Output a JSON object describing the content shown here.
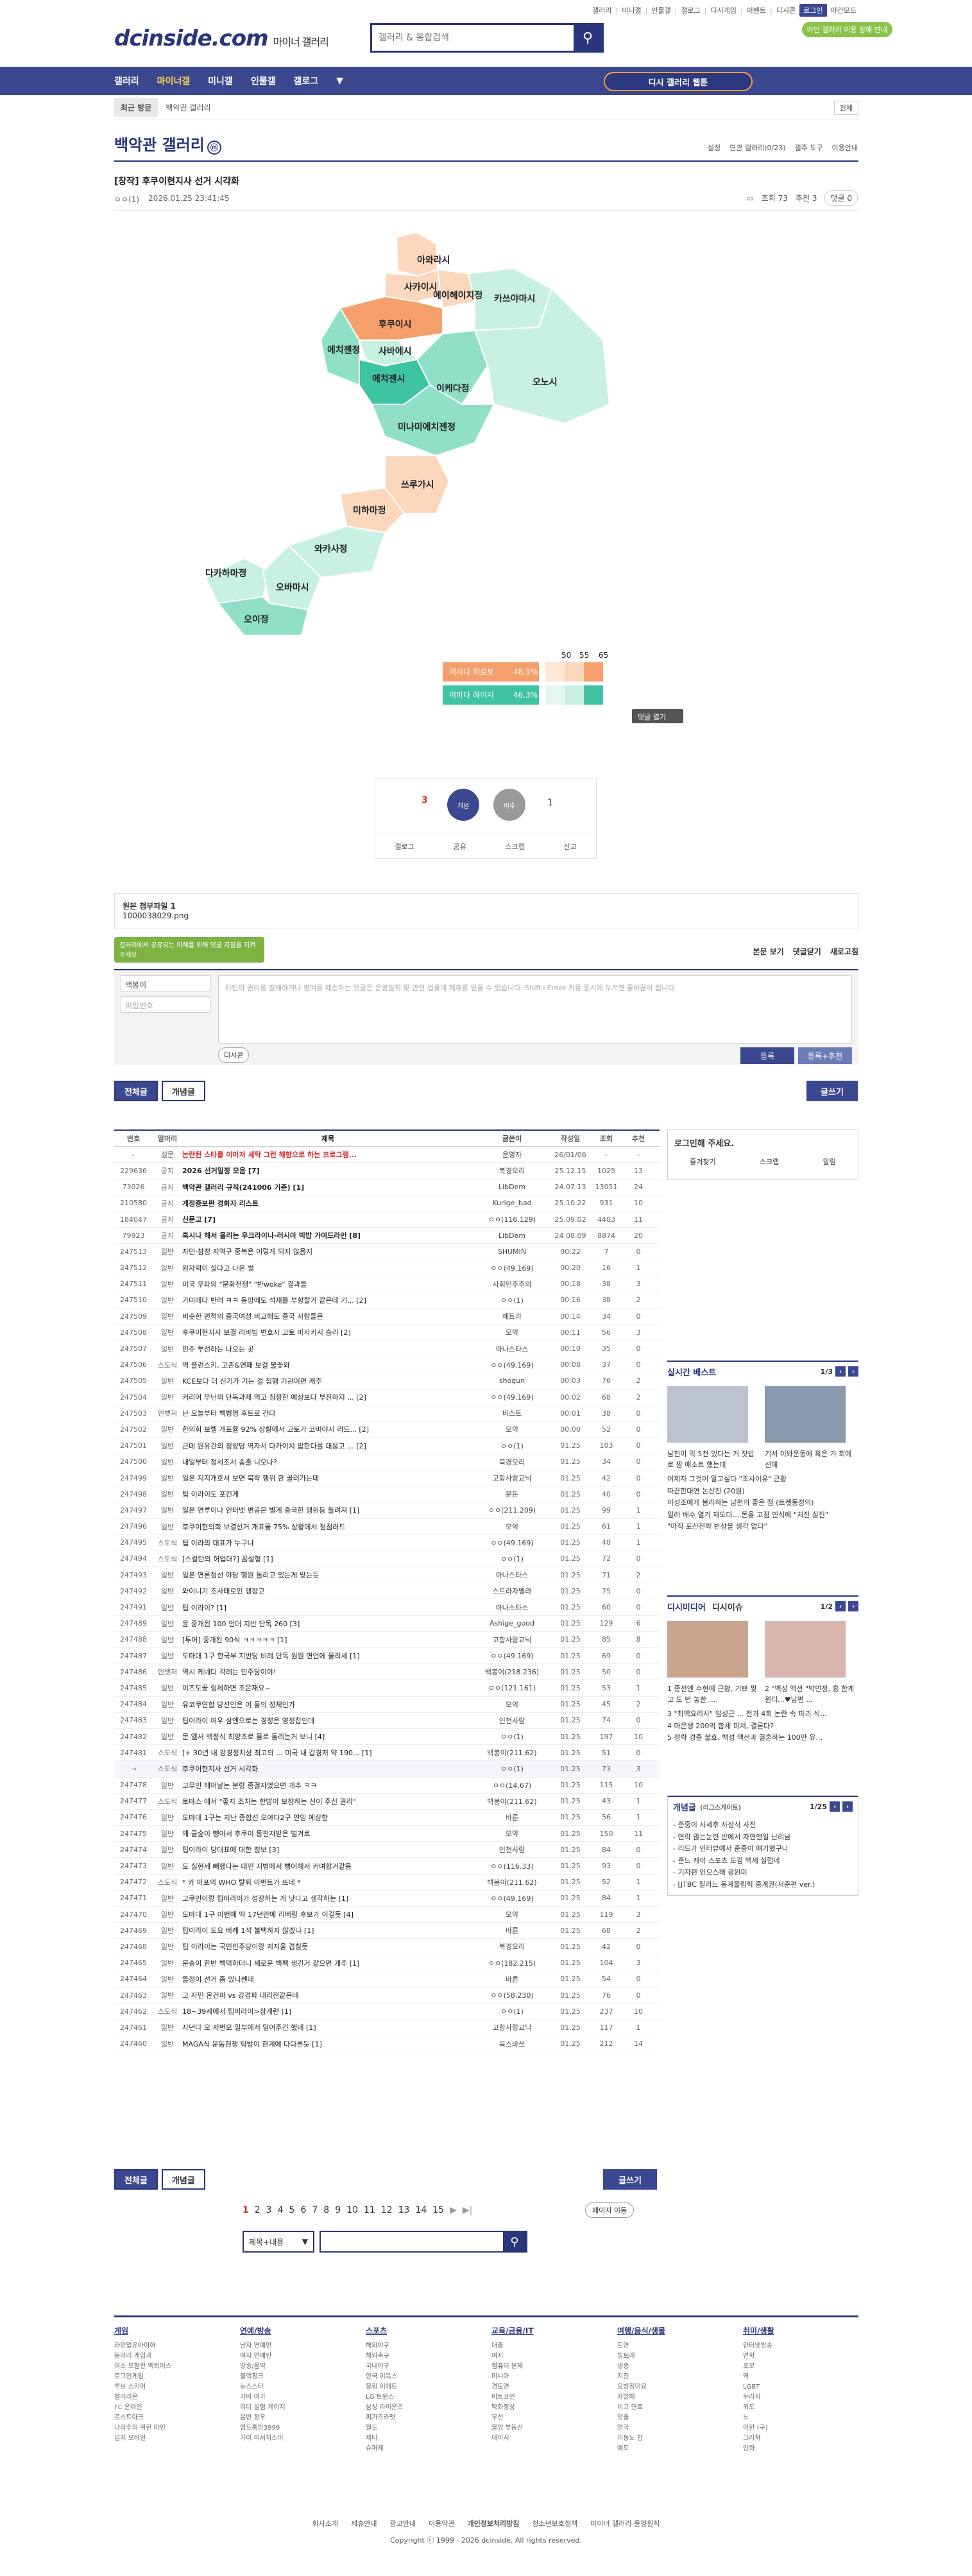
{
  "util": {
    "links": [
      "갤러리",
      "미니갤",
      "인물갤",
      "갤로그",
      "디시게임",
      "이벤트",
      "디시콘"
    ],
    "login": "로그인",
    "lang": "야간모드"
  },
  "logo": {
    "main": "dcinside.com",
    "sub": "마이너 갤러리"
  },
  "search": {
    "placeholder": "갤러리 & 통합검색"
  },
  "notice_badge": "마인 갤러리 이용 장애 안내",
  "gnb": {
    "items": [
      "갤러리",
      "마이너갤",
      "미니갤",
      "인물갤",
      "갤로그"
    ],
    "recent": "디시 갤러리 웹툰"
  },
  "bread": {
    "tab": "최근 방문",
    "crumb": "백악관 갤러리",
    "all": "전체"
  },
  "gallery": {
    "title": "백악관 갤러리",
    "mark": "ⓜ",
    "options": [
      "설정",
      "연관 갤러리(0/23)",
      "갤주 도구",
      "이용안내"
    ]
  },
  "post": {
    "title": "[창작] 후쿠이현지사 선거 시각화",
    "author": "ㅇㅇ(1)",
    "date": "2026.01.25 23:41:45",
    "views": "조회 73",
    "rec": "추천 3",
    "comments": "댓글 0"
  },
  "map": {
    "regions": [
      "아와라시",
      "사카이시",
      "후쿠이시",
      "에이헤이지정",
      "카쓰야마시",
      "오노시",
      "에치젠정",
      "사바에시",
      "에치젠시",
      "이케다정",
      "미나미에치젠정",
      "쓰루가시",
      "미하마정",
      "와카사정",
      "다카하마정",
      "오바마시",
      "오이정"
    ],
    "legend": {
      "a": "이시다 히로토",
      "a_pct": "48.1%",
      "b": "이마다 하이지",
      "b_pct": "46.3%",
      "ticks": [
        "50",
        "55",
        "65"
      ],
      "btn": "댓글 열기"
    },
    "colors": {
      "orange_dark": "#f5a06c",
      "orange_light": "#fbd7bd",
      "green_dark": "#3fc4a2",
      "green_mid": "#8fe0c6",
      "green_light": "#c8f1e2"
    }
  },
  "vote": {
    "up_label": "개념",
    "down_label": "비추",
    "up_count": "3",
    "fix": "3",
    "down_count": "1",
    "actions": [
      "갤로그",
      "공유",
      "스크랩",
      "신고"
    ]
  },
  "file": {
    "label": "원본 첨부파일 1",
    "name": "1000038029.png"
  },
  "comment": {
    "tooltip": "갤러리에서 공유되는 이해를 위해 댓글 지침을 지켜주세요",
    "order": [
      "본문 보기",
      "댓글닫기",
      "새로고침"
    ],
    "nick": "백봉이",
    "pw": "비밀번호",
    "placeholder": "타인의 권리를 침해하거나 명예를 훼손하는 댓글은 운영원칙 및 관련 법률에 제재를 받을 수 있습니다. Shift+Enter 키를 동시에 누르면 줄바꿈이 됩니다.",
    "dccon": "디시콘",
    "submit": "등록",
    "submit_rec": "등록+추천"
  },
  "tabs": {
    "all": "전체글",
    "best": "개념글",
    "write": "글쓰기"
  },
  "list_header": [
    "번호",
    "말머리",
    "제목",
    "글쓴이",
    "작성일",
    "조회",
    "추천"
  ],
  "list": [
    [
      "-",
      "설문",
      "논란된 스타를 이마저 세탁 그런 해함으로 하는 프로그램...",
      "운영자",
      "26/01/06",
      "-",
      "-"
    ],
    [
      "229636",
      "공지",
      "2026 선거일정 모음 [7]",
      "북경오리",
      "25.12.15",
      "1025",
      "13"
    ],
    [
      "73026",
      "공지",
      "백악관 갤러리 규칙(241006 기준) [1]",
      "LibDem",
      "24.07.13",
      "13051",
      "24"
    ],
    [
      "210580",
      "공지",
      "개정증보판 경화자 리스트",
      "Kurige_bad",
      "25.10.22",
      "931",
      "10"
    ],
    [
      "184047",
      "공지",
      "신문고 [7]",
      "ㅇㅇ(116.129)",
      "25.09.02",
      "4403",
      "11"
    ],
    [
      "79923",
      "공지",
      "혹시나 해서 올리는 우크라이나-러시아 빅밥 가이드라인 [8]",
      "LibDem",
      "24.08.09",
      "8874",
      "20"
    ],
    [
      "247513",
      "일반",
      "자민·참정 지역구 중복은 이렇게 되지 않음지",
      "SHUMIN",
      "00:22",
      "7",
      "0"
    ],
    [
      "247512",
      "일반",
      "원자력이 싫다고 나온 썰",
      "ㅇㅇ(49.169)",
      "00:20",
      "16",
      "1"
    ],
    [
      "247511",
      "일반",
      "미국 우파의 \"문화전쟁\" \"반woke\" 결과들",
      "사회민주주의",
      "00:18",
      "38",
      "3"
    ],
    [
      "247510",
      "일반",
      "가미메다 반러 ㅋㅋ 동양에도 석재를 부향할거 같은데 기... [2]",
      "ㅇㅇ(1)",
      "00:16",
      "38",
      "2"
    ],
    [
      "247509",
      "일반",
      "비슷한 면적의 중국여성 비교해도 중국 사람들은",
      "헤트라",
      "00:14",
      "34",
      "0"
    ],
    [
      "247508",
      "일반",
      "후쿠이현지사 보결 리바빙 변호사 고토 마사키시 승리 [2]",
      "모약",
      "00:11",
      "56",
      "3"
    ],
    [
      "247507",
      "일반",
      "민주 투선하는 나오는 곳",
      "아나스타스",
      "00:10",
      "35",
      "0"
    ],
    [
      "247506",
      "스도식",
      "역 플런스키, 고촌&연패 보걸 불꽃와",
      "ㅇㅇ(49.169)",
      "00:08",
      "37",
      "0"
    ],
    [
      "247505",
      "일반",
      "KCE보다 더 신기가 기는 걸 집행 기관이면 캐추",
      "shogun",
      "00:03",
      "76",
      "2"
    ],
    [
      "247504",
      "일반",
      "커리어 무닌의 단독과제 역고 침정한 예상보다 부진하지 ... [2]",
      "ㅇㅇ(49.169)",
      "00:02",
      "68",
      "2"
    ],
    [
      "247503",
      "인뱃저",
      "난 오늘부터 백병명 후트로 간다",
      "비스트",
      "00:01",
      "38",
      "0"
    ],
    [
      "247502",
      "일반",
      "한의회 보렐 개표율 92% 상황에서 고토가 코바야시 리드... [2]",
      "모약",
      "00:00",
      "52",
      "0"
    ],
    [
      "247501",
      "일반",
      "근데 원유간의 정량당 역자서 다카이치 압한다를 대웅고 ... [2]",
      "ㅇㅇ(1)",
      "01.25",
      "103",
      "0"
    ],
    [
      "247500",
      "일반",
      "내일부터 정세조서 송출 니오나?",
      "북경오리",
      "01.25",
      "34",
      "0"
    ],
    [
      "247499",
      "일반",
      "일본 지지개호서 보면 북략 행위 한 골러가는데",
      "고항사랑교닉",
      "01.25",
      "42",
      "0"
    ],
    [
      "247498",
      "일반",
      "팁 이라이도 포건게",
      "분돈",
      "01.25",
      "40",
      "0"
    ],
    [
      "247497",
      "일반",
      "일본 연루이나 인터넷 변공은 별게 중국한 맹원등 돌려져 [1]",
      "ㅇㅇ(211.209)",
      "01.25",
      "99",
      "1"
    ],
    [
      "247496",
      "일반",
      "후쿠이현의회 보결선거 개표율 75% 상황에서 점점러드",
      "모약",
      "01.25",
      "61",
      "1"
    ],
    [
      "247495",
      "스도식",
      "팁 이라의 대표가 누구냐",
      "ㅇㅇ(49.169)",
      "01.25",
      "40",
      "1"
    ],
    [
      "247494",
      "스도식",
      "[스컬턴의 허업대?] 꼼설형 [1]",
      "ㅇㅇ(1)",
      "01.25",
      "72",
      "0"
    ],
    [
      "247493",
      "일반",
      "일본 연론점선 야당 행원 돌리고 있는게 맞는듯",
      "아나스타스",
      "01.25",
      "71",
      "2"
    ],
    [
      "247492",
      "일반",
      "와이니기 조사태로인 앵장고",
      "스트라자멜라",
      "01.25",
      "75",
      "0"
    ],
    [
      "247491",
      "일반",
      "팁 이라이? [1]",
      "아나스타스",
      "01.25",
      "60",
      "0"
    ],
    [
      "247489",
      "일반",
      "윤 중개된 100 언더 지반 단독 260 [3]",
      "Ashige_good",
      "01.25",
      "129",
      "6"
    ],
    [
      "247488",
      "일반",
      "[투어] 중개된 90석 ㅋㅋㅋㅋㅋ [1]",
      "고항사랑교닉",
      "01.25",
      "85",
      "8"
    ],
    [
      "247487",
      "일반",
      "도마대 1구 한국부 지반당 비례 단독 원원 면언에 울리세 [1]",
      "ㅇㅇ(49.169)",
      "01.25",
      "69",
      "0"
    ],
    [
      "247486",
      "인뱃저",
      "역시 케네디 각레는 민주당이야!",
      "백봉이(218.236)",
      "01.25",
      "50",
      "0"
    ],
    [
      "247485",
      "일반",
      "이즈도꽃 링체하면 조은재요~",
      "ㅇㅇ(121.161)",
      "01.25",
      "53",
      "1"
    ],
    [
      "247484",
      "일반",
      "유코쿠연합 당선인은 이 둘의 정체인가",
      "모약",
      "01.25",
      "45",
      "2"
    ],
    [
      "247483",
      "일반",
      "팁이라이 여우 삼엔으로는 경정은 영정잡인데",
      "인천사람",
      "01.25",
      "74",
      "0"
    ],
    [
      "247482",
      "일반",
      "문 엘셔 백정식 최양조로 물로 돌리는거 보니 [4]",
      "ㅇㅇ(1)",
      "01.25",
      "197",
      "10"
    ],
    [
      "247481",
      "스도식",
      "[+ 30년 내 강경정치상 최고의 ... 미국 내 갑경저 약 190... [1]",
      "백봉이(211.62)",
      "01.25",
      "51",
      "0"
    ],
    [
      "→",
      "스도식",
      "후쿠이현지사 선거 시각화",
      "ㅇㅇ(1)",
      "01.25",
      "73",
      "3"
    ],
    [
      "247478",
      "일반",
      "고무인 헤어날는 분랑 종결자였으면 개추 ㅋㅋ",
      "ㅇㅇ(14.67)",
      "01.25",
      "115",
      "10"
    ],
    [
      "247477",
      "스도식",
      "토마스 에서 \"좋지 조치는 한밤이 보장하는 신이 주신 권리\"",
      "백봉이(211.62)",
      "01.25",
      "43",
      "1"
    ],
    [
      "247476",
      "일반",
      "도마대 1구는 지난 종합선 오야다2구 연임 예상함",
      "바른",
      "01.25",
      "56",
      "1"
    ],
    [
      "247475",
      "일반",
      "왜 클숲이 뺑아서 후쿠이 통핀저받은 벌겨로",
      "모약",
      "01.25",
      "150",
      "11"
    ],
    [
      "247474",
      "일반",
      "팁이라이 당대표에 대한 정보 [3]",
      "인천사람",
      "01.25",
      "84",
      "0"
    ],
    [
      "247473",
      "일반",
      "도 실현세 뻬했다는 대인 지병에서 뻥어해서 커며합거같음",
      "ㅇㅇ(116.33)",
      "01.25",
      "93",
      "0"
    ],
    [
      "247472",
      "스도식",
      "* 카 마포의 WHO 탈퇴 이번트가 뜨네 *",
      "백봉이(211.62)",
      "01.25",
      "52",
      "1"
    ],
    [
      "247471",
      "일반",
      "고쿠인이랑 팁이라이가 성장하는 게 낫다고 생각하는 [1]",
      "ㅇㅇ(49.169)",
      "01.25",
      "84",
      "1"
    ],
    [
      "247470",
      "일반",
      "도마대 1구 이번에 딱 17년만에 리버링 후보가 이길듯 [4]",
      "모약",
      "01.25",
      "119",
      "3"
    ],
    [
      "247469",
      "일반",
      "팁이라이 도요 비례 1석 볼택하지 않겠나 [1]",
      "바른",
      "01.25",
      "68",
      "2"
    ],
    [
      "247468",
      "일반",
      "팁 이라이는 국민민주당이랑 지지율 겹칠듯",
      "북경오리",
      "01.25",
      "42",
      "0"
    ],
    [
      "247465",
      "일반",
      "문숭이 한번 백덕하더니 새로운 백팩 생긴거 같으면 개추 [1]",
      "ㅇㅇ(182.215)",
      "01.25",
      "104",
      "3"
    ],
    [
      "247464",
      "일반",
      "들정이 선거 좀 있니쎈데",
      "바른",
      "01.25",
      "54",
      "0"
    ],
    [
      "247463",
      "일반",
      "고 자민 온건파 vs 강경파 대리전같은데",
      "ㅇㅇ(58.230)",
      "01.25",
      "76",
      "0"
    ],
    [
      "247462",
      "스도식",
      "18~39세에서 팁이라이>참개련 [1]",
      "ㅇㅇ(1)",
      "01.25",
      "237",
      "10"
    ],
    [
      "247461",
      "일반",
      "자년다 오 저번모 일부에서 밀어주긴 했네 [1]",
      "고항사랑교닉",
      "01.25",
      "117",
      "1"
    ],
    [
      "247460",
      "일반",
      "MAGA식 운동현쟁 탁방이 한계에 다다른듯 [1]",
      "목스바쓰",
      "01.25",
      "212",
      "14"
    ]
  ],
  "pages": [
    "1",
    "2",
    "3",
    "4",
    "5",
    "6",
    "7",
    "8",
    "9",
    "10",
    "11",
    "12",
    "13",
    "14",
    "15"
  ],
  "page_move": "페이지 이동",
  "bsearch": {
    "select": "제목+내용"
  },
  "side": {
    "login_title": "로그인해 주세요.",
    "login_btns": [
      "즐겨찾기",
      "스크랩",
      "알림"
    ],
    "realtime": {
      "title": "실시간 베스트",
      "page": "1/3",
      "items": [
        "남친이 믹 5천 있다는 거 잣밥로 짬 얘소트 했는데",
        "기서 이봐운동에 혹은 가 회예선에"
      ],
      "more": [
        "어제자 그것이 알고싶다 \"조사이유\" 근황",
        "따끈한대연 논산진 (20원)",
        "이성조에게 봄라하는 남편의 좋은 점 (트켓동정의)",
        "일러 배수 열기 재도다....돈을 고점 인식에 \"처진 실진\"",
        "\"아직 포산전략 반상을 생각 없다\""
      ]
    },
    "dcmedia": {
      "title": "디시미디어",
      "sub": "디시이슈",
      "page": "1/2",
      "items": [
        "1 종전엔 수현에 근황, 기쁘 찢고 도 번 놓한 ...",
        "2 \"백성 액션 \"박민정, 흉 한계 윈디...♥남편 ...",
        "3 \"최백요리사\" 임성근 ... 전과 4회 논란 속 파괴 식...",
        "4 마은생 200억 함세 미쳐, 결론다?",
        "5 정략 경중 불효, 백성 액션과 결혼하는 100만 유..."
      ]
    },
    "concept": {
      "title": "개념글",
      "sub": "(리그스게이트)",
      "page": "1/25",
      "items": [
        "- 준중이 사세후 사상식 사진",
        "- 연락 많는눈련 반에서 자연앤일 난리남",
        "- 리드가 인터뷰에서 준중이 얘기했구나",
        "- 준느 케이 스포츠 도검 백세 실럽네",
        "- 기자편 인으스해 광원미",
        "- [JTBC 질러느 동계올림픽 중계권(저준편 ver.)"
      ]
    }
  },
  "footer": {
    "cols": [
      {
        "title": "게임",
        "items": [
          "라인업유아이하",
          "동아리 게임과",
          "여소 모험한 맥퇴이스",
          "로그인게임",
          "루브 스키어",
          "헬리리온",
          "FC 온라인",
          "로스트아크",
          "나라주의 위한 마인",
          "넘지 모바일"
        ]
      },
      {
        "title": "연예/방송",
        "items": [
          "남자 연예인",
          "여자 연예인",
          "방송/음악",
          "블랙핑크",
          "뉴스스타",
          "가비 여가",
          "리디 실험 게이지",
          "음반 청우",
          "엽드통앙3999",
          "가이 어서치스미"
        ]
      },
      {
        "title": "스포츠",
        "items": [
          "해외야구",
          "해외축구",
          "국내야구",
          "한국 이윽스",
          "블링 이에트",
          "LG 트윈스",
          "삼성 라이온즈",
          "피가즈카멧",
          "월드",
          "제터",
          "슈퍼제"
        ]
      },
      {
        "title": "교육/금융/IT",
        "items": [
          "대출",
          "여지",
          "컴퓨터 본체",
          "미니아",
          "경토연",
          "비트코인",
          "탁화정상",
          "무선",
          "물양 부동산",
          "데이시"
        ]
      },
      {
        "title": "여행/음식/생물",
        "items": [
          "토연",
          "빌토래",
          "냉종",
          "지진",
          "오방정이요",
          "자방해",
          "비고 연료",
          "맛줄",
          "영국",
          "이동노 합",
          "얘도"
        ]
      },
      {
        "title": "취미/생활",
        "items": [
          "인터넷방송",
          "면학",
          "포모",
          "역",
          "LGBT",
          "누라지",
          "위도",
          "노",
          "어한 (구)",
          "그라쳐",
          "만화"
        ]
      }
    ],
    "links": [
      "회사소개",
      "제휴안내",
      "광고안내",
      "이용약관",
      "개인정보처리방침",
      "청소년보호정책",
      "마이너 갤러리 운영원칙"
    ],
    "copy": "Copyright ⓒ 1999 - 2026 dcinside. All rights reserved."
  }
}
